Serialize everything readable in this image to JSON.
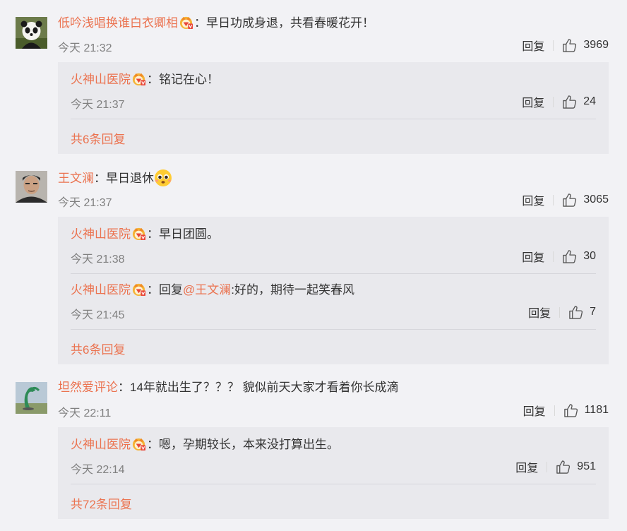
{
  "comments": [
    {
      "user": "低吟浅唱换谁白衣卿相",
      "sep": "：",
      "text": "早日功成身退，共看春暖花开！",
      "time": "今天 21:32",
      "reply_label": "回复",
      "likes": "3969",
      "replies": [
        {
          "user": "火神山医院",
          "sep": "：",
          "text": "铭记在心！",
          "time": "今天 21:37",
          "reply_label": "回复",
          "likes": "24"
        }
      ],
      "more": "共6条回复"
    },
    {
      "user": "王文澜",
      "sep": "：",
      "text": "早日退休",
      "time": "今天 21:37",
      "reply_label": "回复",
      "likes": "3065",
      "replies": [
        {
          "user": "火神山医院",
          "sep": "：",
          "text": "早日团圆。",
          "time": "今天 21:38",
          "reply_label": "回复",
          "likes": "30"
        },
        {
          "user": "火神山医院",
          "sep": "：",
          "prefix": "回复",
          "mention": "@王文澜",
          "text": ":好的，期待一起笑春风",
          "time": "今天 21:45",
          "reply_label": "回复",
          "likes": "7"
        }
      ],
      "more": "共6条回复"
    },
    {
      "user": "坦然爱评论",
      "sep": "：",
      "text": "14年就出生了？？？ 貌似前天大家才看着你长成滴",
      "time": "今天 22:11",
      "reply_label": "回复",
      "likes": "1181",
      "replies": [
        {
          "user": "火神山医院",
          "sep": "：",
          "text": "嗯，孕期较长，本来没打算出生。",
          "time": "今天 22:14",
          "reply_label": "回复",
          "likes": "951"
        }
      ],
      "more": "共72条回复"
    }
  ],
  "colors": {
    "username": "#eb7350",
    "background": "#f2f2f5",
    "subpanel": "#e9e9ed",
    "time": "#808080"
  },
  "icons": {
    "badge": "vip-crown-badge-icon",
    "like": "thumbs-up-icon",
    "emoji": "pleading-face-emoji-icon"
  }
}
